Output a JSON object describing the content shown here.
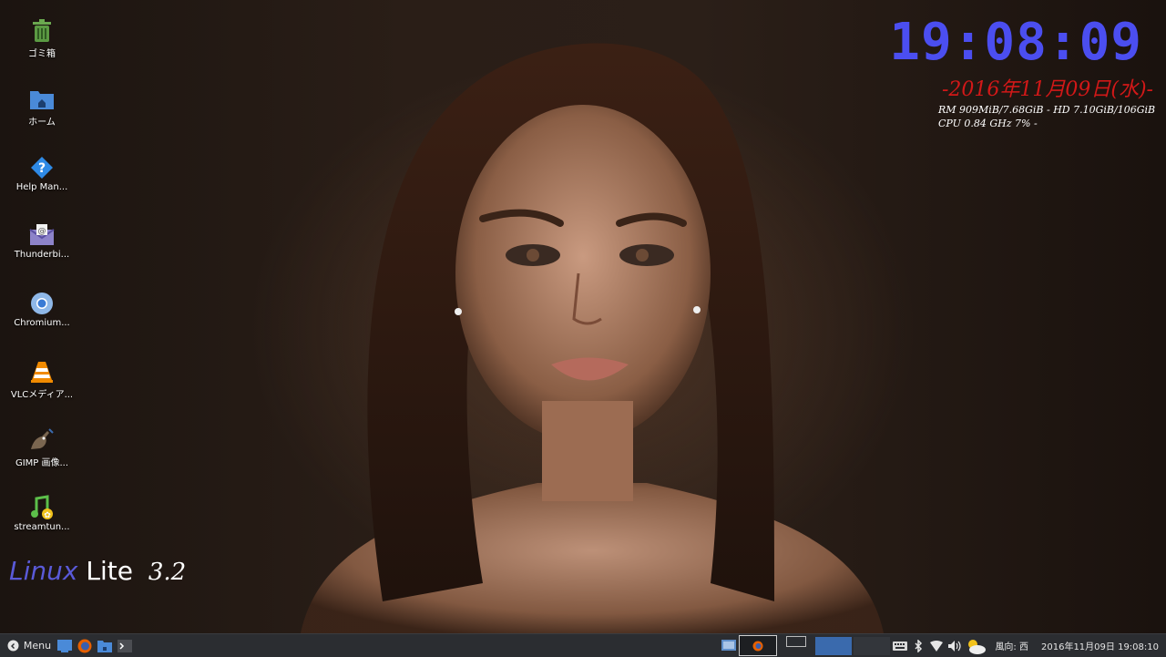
{
  "desktop_icons": [
    {
      "label": "ゴミ箱",
      "icon": "trash-icon"
    },
    {
      "label": "ホーム",
      "icon": "home-folder-icon"
    },
    {
      "label": "Help Man...",
      "icon": "help-icon"
    },
    {
      "label": "Thunderbi...",
      "icon": "mail-icon"
    },
    {
      "label": "Chromium...",
      "icon": "chromium-icon"
    },
    {
      "label": "VLCメディア...",
      "icon": "vlc-icon"
    },
    {
      "label": "GIMP 画像...",
      "icon": "gimp-icon"
    },
    {
      "label": "streamtun...",
      "icon": "music-icon"
    }
  ],
  "branding": {
    "word1": "Linux",
    "word2": "Lite",
    "version": "3.2"
  },
  "conky": {
    "time": "19:08:09",
    "date": "-2016年11月09日(水)-",
    "line1": "RM 909MiB/7.68GiB - HD 7.10GiB/106GiB",
    "line2": "CPU 0.84 GHz 7% -"
  },
  "taskbar": {
    "menu_label": "Menu",
    "wind_label": "風向: 西",
    "datetime": "2016年11月09日 19:08:10"
  },
  "colors": {
    "clock": "#4b4ef0",
    "date": "#d21818",
    "workspace_active": "#3a6aad",
    "taskbar": "#2b2d31"
  }
}
